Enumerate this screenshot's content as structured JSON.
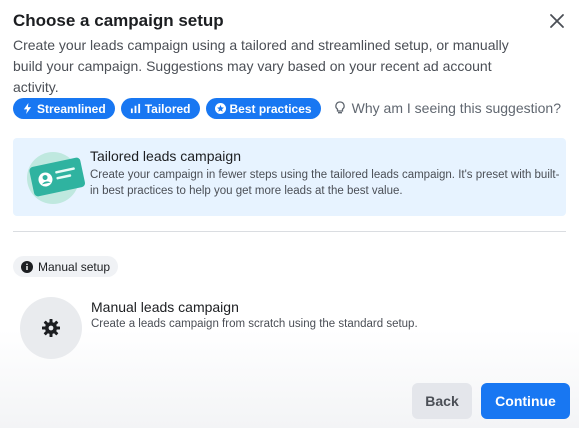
{
  "dialog": {
    "title": "Choose a campaign setup",
    "subtitle": "Create your leads campaign using a tailored and streamlined setup, or manually build your campaign. Suggestions may vary based on your recent ad account activity.",
    "close_icon": "close-icon"
  },
  "pills": [
    {
      "label": "Streamlined",
      "icon": "lightning-icon"
    },
    {
      "label": "Tailored",
      "icon": "bar-chart-icon"
    },
    {
      "label": "Best practices",
      "icon": "star-badge-icon"
    }
  ],
  "why": {
    "label": "Why am I seeing this suggestion?",
    "icon": "lightbulb-icon"
  },
  "tailored": {
    "title": "Tailored leads campaign",
    "description": "Create your campaign in fewer steps using the tailored leads campaign. It's preset with built-in best practices to help you get more leads at the best value."
  },
  "manual": {
    "badge": "Manual setup",
    "badge_icon": "info-icon",
    "icon": "gear-icon",
    "title": "Manual leads campaign",
    "description": "Create a leads campaign from scratch using the standard setup."
  },
  "buttons": {
    "back": "Back",
    "continue": "Continue"
  },
  "colors": {
    "primary": "#1877f2",
    "selected_card": "#e7f3ff",
    "illustration": "#2fb3a0"
  }
}
